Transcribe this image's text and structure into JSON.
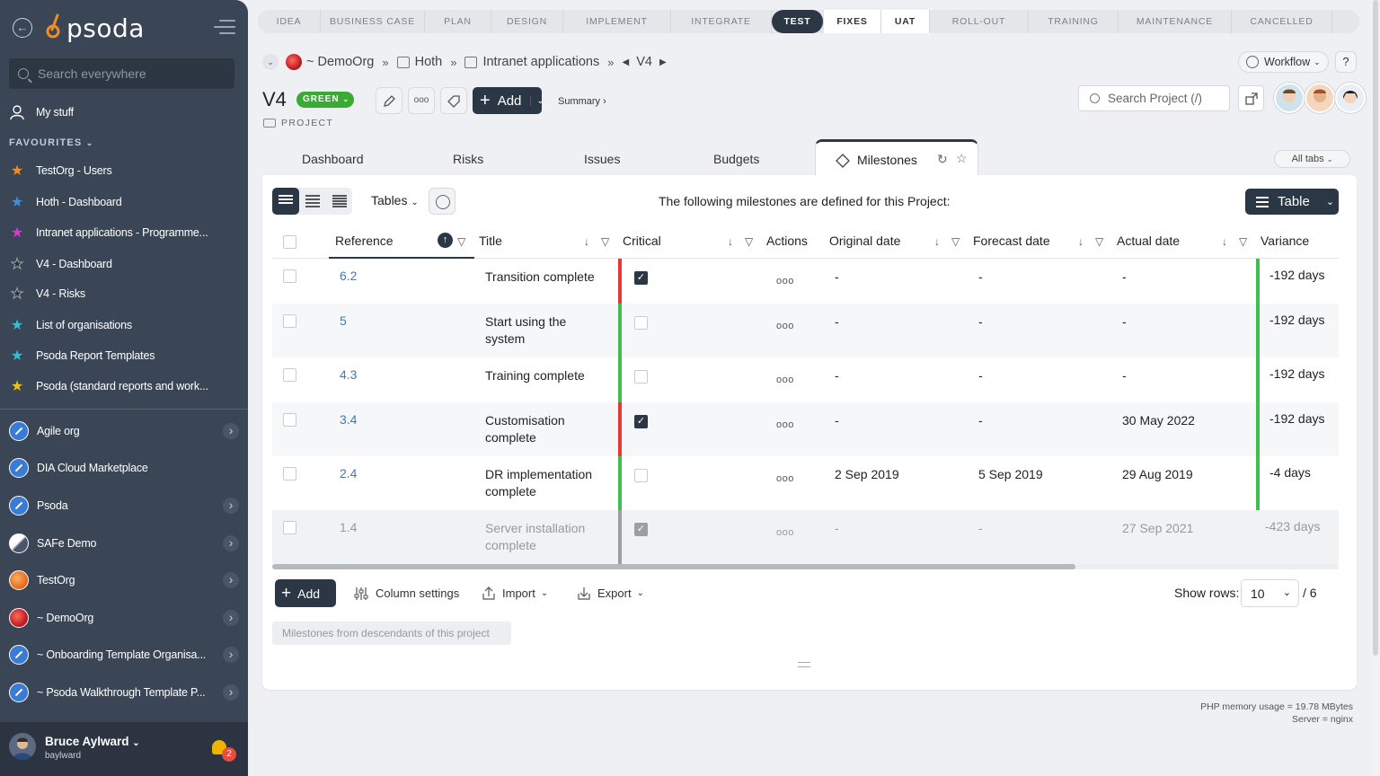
{
  "sidebar": {
    "search_placeholder": "Search everywhere",
    "my_stuff": "My stuff",
    "favourites_heading": "FAVOURITES",
    "favourites": [
      {
        "label": "TestOrg - Users",
        "color": "#f28c28"
      },
      {
        "label": "Hoth - Dashboard",
        "color": "#3b8fe0"
      },
      {
        "label": "Intranet applications - Programme...",
        "color": "#d63ad0"
      },
      {
        "label": "V4 - Dashboard",
        "color": "#2b2f36"
      },
      {
        "label": "V4 - Risks",
        "color": "#2b2f36"
      },
      {
        "label": "List of organisations",
        "color": "#3bb9d6"
      },
      {
        "label": "Psoda Report Templates",
        "color": "#3bb9d6"
      },
      {
        "label": "Psoda (standard reports and work...",
        "color": "#f0c020"
      }
    ],
    "orgs": [
      {
        "label": "Agile org",
        "chevron": true
      },
      {
        "label": "DIA Cloud Marketplace",
        "chevron": false
      },
      {
        "label": "Psoda",
        "chevron": true
      },
      {
        "label": "SAFe Demo",
        "chevron": true
      },
      {
        "label": "TestOrg",
        "chevron": true
      },
      {
        "label": "~ DemoOrg",
        "chevron": true
      },
      {
        "label": "~ Onboarding Template Organisa...",
        "chevron": true
      },
      {
        "label": "~ Psoda Walkthrough Template P...",
        "chevron": true
      }
    ],
    "user": {
      "name": "Bruce Aylward",
      "login": "baylward",
      "notifications": "2"
    }
  },
  "logo_text": "psoda",
  "phases": [
    "IDEA",
    "BUSINESS CASE",
    "PLAN",
    "DESIGN",
    "IMPLEMENT",
    "INTEGRATE",
    "TEST",
    "FIXES",
    "UAT",
    "ROLL-OUT",
    "TRAINING",
    "MAINTENANCE",
    "CANCELLED"
  ],
  "breadcrumb": {
    "org": "~ DemoOrg",
    "portfolio": "Hoth",
    "programme": "Intranet applications",
    "project": "V4"
  },
  "workflow_label": "Workflow",
  "help_label": "?",
  "project": {
    "title": "V4",
    "status": "GREEN",
    "type_label": "PROJECT"
  },
  "toolbar": {
    "add_label": "Add",
    "summary_label": "Summary ›",
    "more_label": "ooo"
  },
  "project_search_placeholder": "Search Project (/)",
  "tabs": [
    "Dashboard",
    "Risks",
    "Issues",
    "Budgets",
    "Milestones"
  ],
  "all_tabs_label": "All tabs",
  "panel": {
    "tables_label": "Tables",
    "intro": "The following milestones are defined for this Project:",
    "view_label": "Table"
  },
  "columns": [
    "Reference",
    "Title",
    "Critical",
    "Actions",
    "Original date",
    "Forecast date",
    "Actual date",
    "Variance"
  ],
  "rows": [
    {
      "ref": "6.2",
      "title": "Transition complete",
      "critical": true,
      "original": "-",
      "forecast": "-",
      "actual": "-",
      "variance": "-192 days",
      "flag": "#e53935",
      "vflag": "#3fbf4f"
    },
    {
      "ref": "5",
      "title": "Start using the system",
      "critical": false,
      "original": "-",
      "forecast": "-",
      "actual": "-",
      "variance": "-192 days",
      "flag": "#3fbf4f",
      "vflag": "#3fbf4f"
    },
    {
      "ref": "4.3",
      "title": "Training complete",
      "critical": false,
      "original": "-",
      "forecast": "-",
      "actual": "-",
      "variance": "-192 days",
      "flag": "#3fbf4f",
      "vflag": "#3fbf4f"
    },
    {
      "ref": "3.4",
      "title": "Customisation complete",
      "critical": true,
      "original": "-",
      "forecast": "-",
      "actual": "30 May 2022",
      "variance": "-192 days",
      "flag": "#e53935",
      "vflag": "#3fbf4f"
    },
    {
      "ref": "2.4",
      "title": "DR implementation complete",
      "critical": false,
      "original": "2 Sep 2019",
      "forecast": "5 Sep 2019",
      "actual": "29 Aug 2019",
      "variance": "-4 days",
      "flag": "#3fbf4f",
      "vflag": "#3fbf4f"
    },
    {
      "ref": "1.4",
      "title": "Server installation complete",
      "critical": true,
      "original": "-",
      "forecast": "-",
      "actual": "27 Sep 2021",
      "variance": "-423 days",
      "flag": "#9e9e9e",
      "vflag": ""
    }
  ],
  "table_footer": {
    "add_label": "Add",
    "column_settings": "Column settings",
    "import_label": "Import",
    "export_label": "Export",
    "show_rows_label": "Show rows:",
    "rows_value": "10",
    "total": "/ 6",
    "descendants_label": "Milestones from descendants of this project"
  },
  "footer": {
    "memory": "PHP memory usage = 19.78 MBytes",
    "server": "Server = nginx"
  }
}
